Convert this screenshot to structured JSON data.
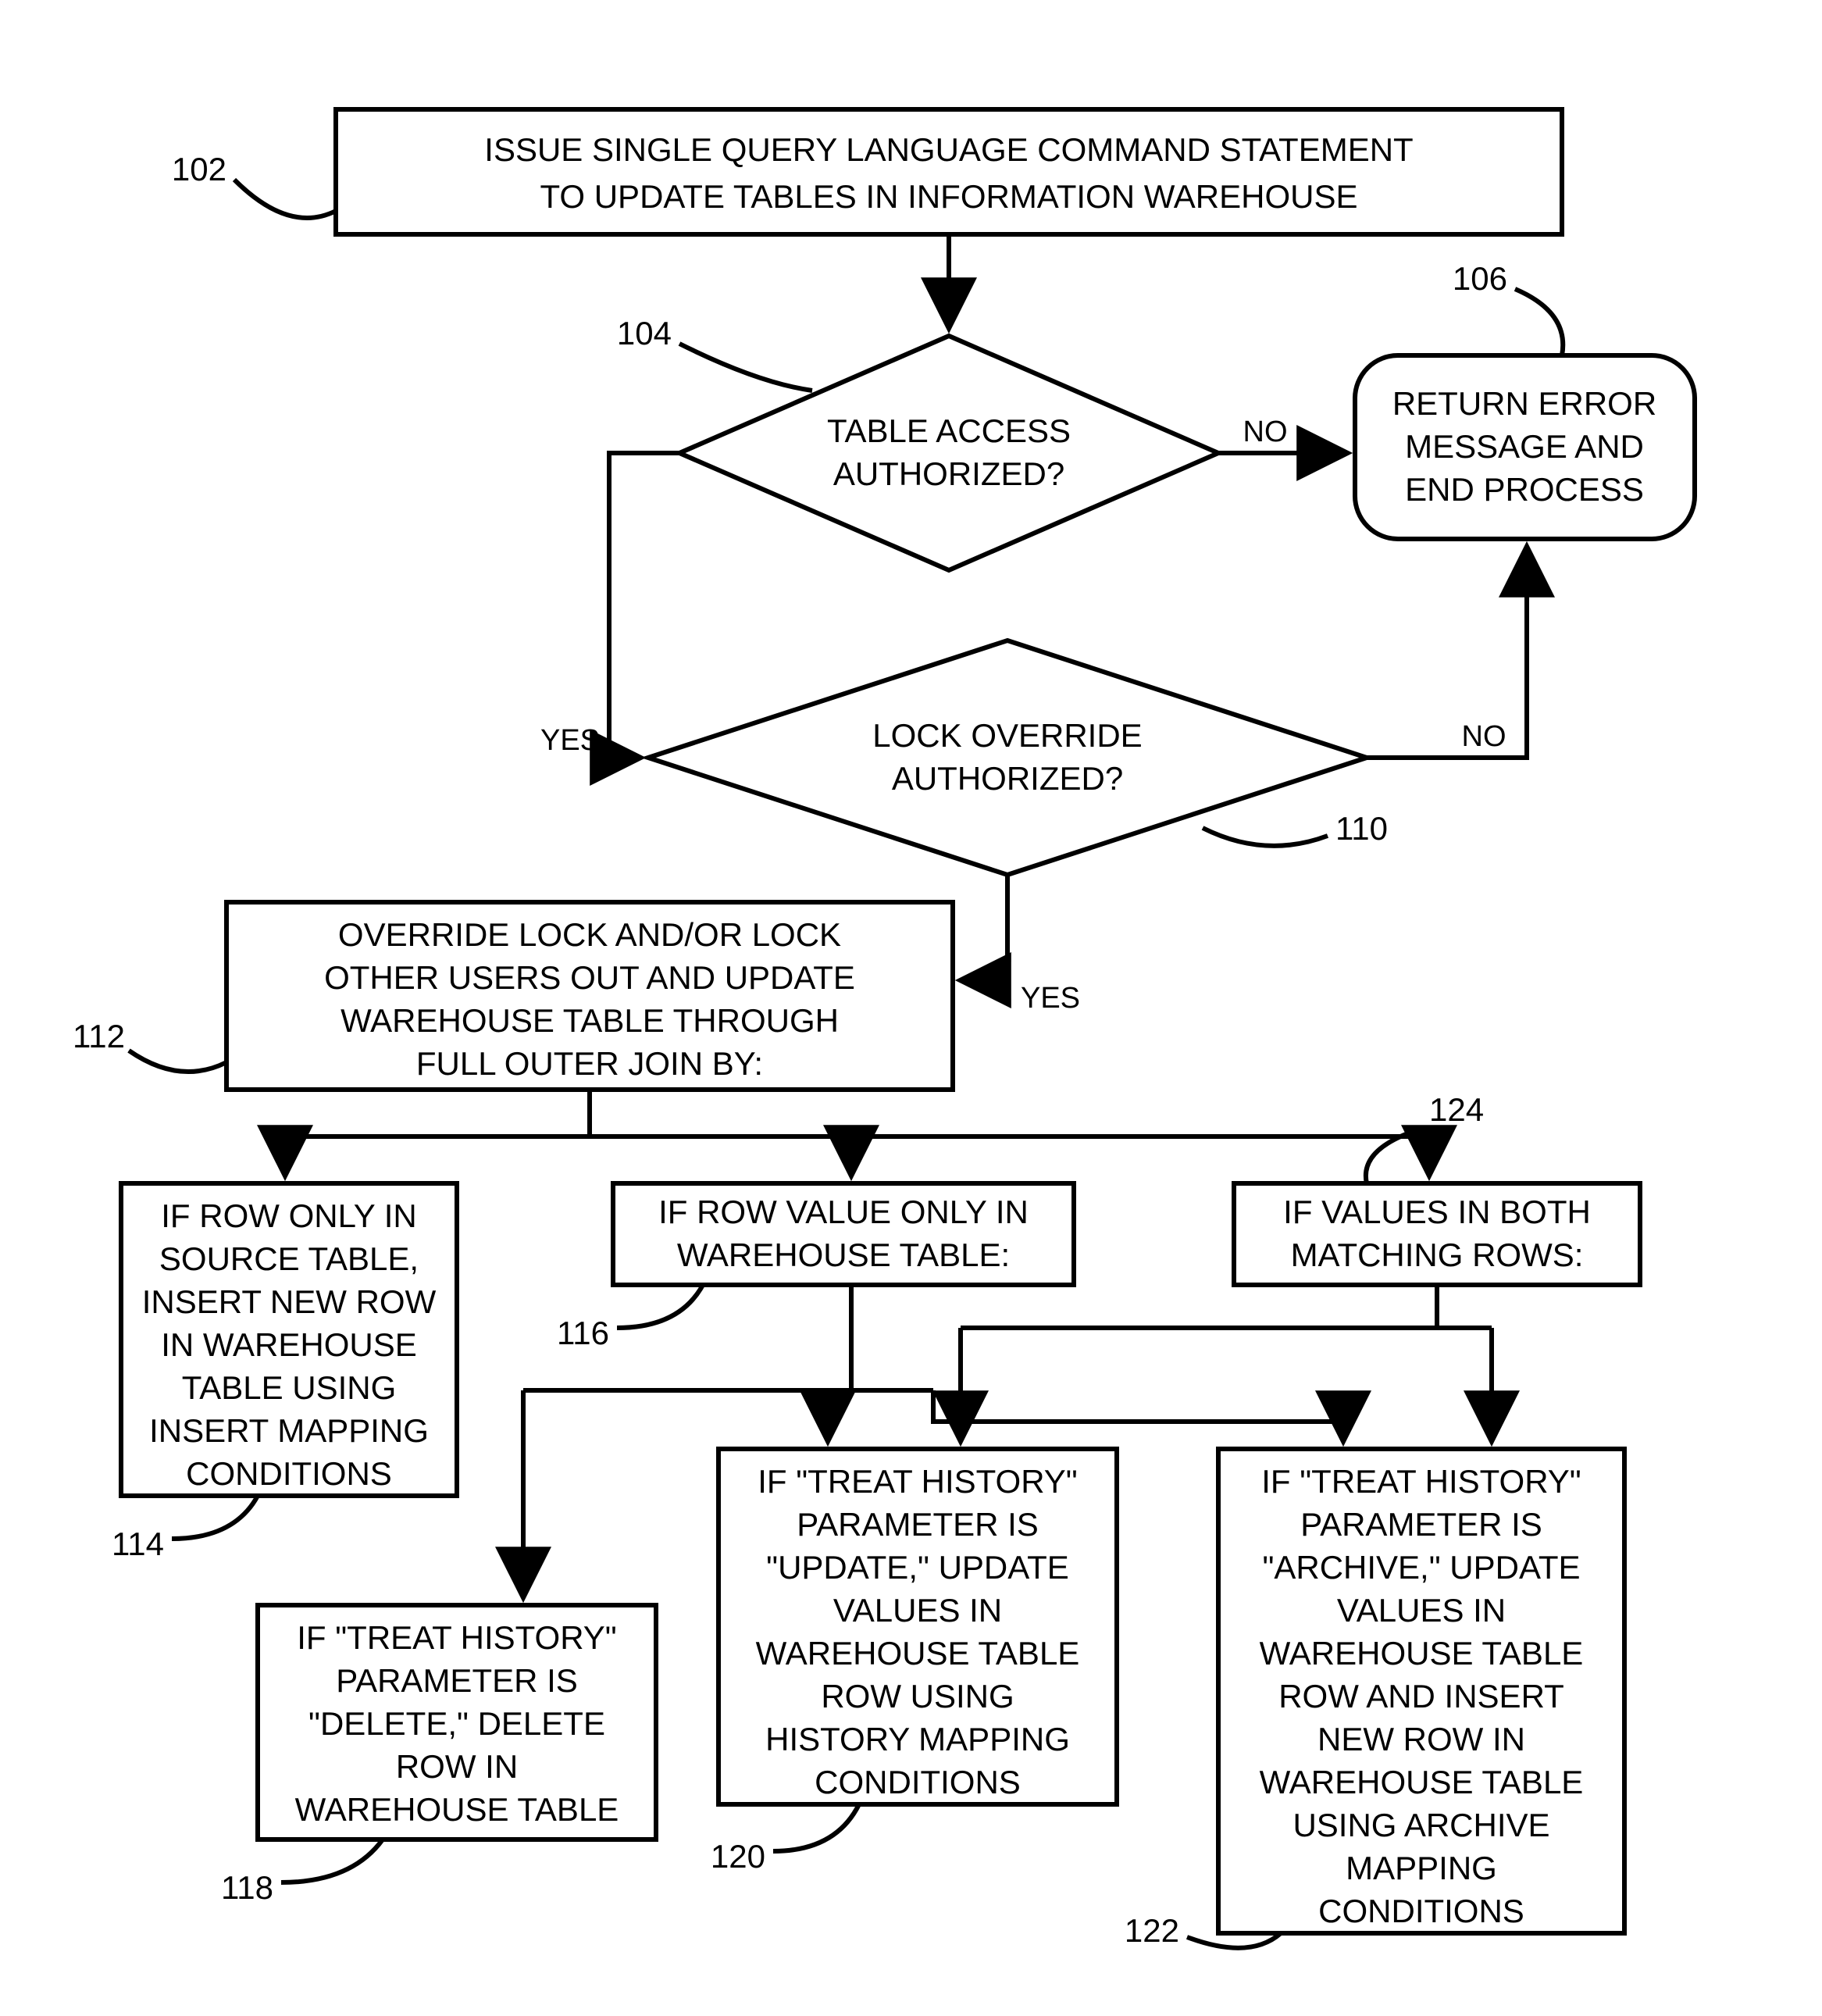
{
  "nodes": {
    "n102": {
      "ref": "102",
      "lines": [
        "ISSUE SINGLE QUERY LANGUAGE COMMAND STATEMENT",
        "TO UPDATE TABLES IN INFORMATION WAREHOUSE"
      ]
    },
    "n104": {
      "ref": "104",
      "lines": [
        "TABLE ACCESS",
        "AUTHORIZED?"
      ]
    },
    "n106": {
      "ref": "106",
      "lines": [
        "RETURN ERROR",
        "MESSAGE AND",
        "END PROCESS"
      ]
    },
    "n110": {
      "ref": "110",
      "lines": [
        "LOCK OVERRIDE",
        "AUTHORIZED?"
      ]
    },
    "n112": {
      "ref": "112",
      "lines": [
        "OVERRIDE LOCK AND/OR LOCK",
        "OTHER USERS OUT AND UPDATE",
        "WAREHOUSE TABLE THROUGH",
        "FULL OUTER JOIN BY:"
      ]
    },
    "n114": {
      "ref": "114",
      "lines": [
        "IF ROW ONLY IN",
        "SOURCE TABLE,",
        "INSERT NEW ROW",
        "IN WAREHOUSE",
        "TABLE USING",
        "INSERT MAPPING",
        "CONDITIONS"
      ]
    },
    "n116": {
      "ref": "116",
      "lines": [
        "IF ROW VALUE ONLY IN",
        "WAREHOUSE TABLE:"
      ]
    },
    "n118": {
      "ref": "118",
      "lines": [
        "IF \"TREAT HISTORY\"",
        "PARAMETER IS",
        "\"DELETE,\" DELETE",
        "ROW IN",
        "WAREHOUSE TABLE"
      ]
    },
    "n120": {
      "ref": "120",
      "lines": [
        "IF \"TREAT HISTORY\"",
        "PARAMETER IS",
        "\"UPDATE,\" UPDATE",
        "VALUES IN",
        "WAREHOUSE TABLE",
        "ROW USING",
        "HISTORY MAPPING",
        "CONDITIONS"
      ]
    },
    "n122": {
      "ref": "122",
      "lines": [
        "IF \"TREAT HISTORY\"",
        "PARAMETER IS",
        "\"ARCHIVE,\" UPDATE",
        "VALUES IN",
        "WAREHOUSE TABLE",
        "ROW AND INSERT",
        "NEW ROW IN",
        "WAREHOUSE TABLE",
        "USING ARCHIVE",
        "MAPPING",
        "CONDITIONS"
      ]
    },
    "n124": {
      "ref": "124",
      "lines": [
        "IF VALUES IN BOTH",
        "MATCHING ROWS:"
      ]
    }
  },
  "edges": {
    "yes": "YES",
    "no": "NO"
  }
}
